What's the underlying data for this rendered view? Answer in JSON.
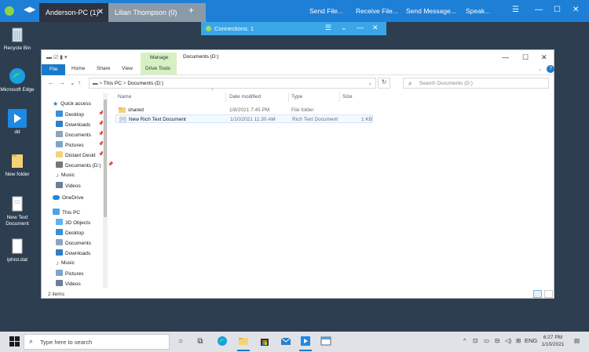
{
  "topbar": {
    "tabs": [
      {
        "label": "Anderson-PC (1)",
        "close": "✕"
      },
      {
        "label": "Lilian Thompson (0)"
      }
    ],
    "new_tab": "+",
    "actions": [
      "Send File...",
      "Receive File...",
      "Send Message...",
      "Speak..."
    ]
  },
  "connections": {
    "label": "Connections: 1"
  },
  "desktop": {
    "icons": [
      "Recycle Bin",
      "Microsoft Edge",
      "dd",
      "New folder",
      "New Text Document",
      "iphist.dat"
    ]
  },
  "explorer": {
    "title": "Documents (D:)",
    "ribbon": {
      "file": "File",
      "tabs": [
        "Home",
        "Share",
        "View"
      ],
      "manage": "Manage",
      "drive_tools": "Drive Tools"
    },
    "address": {
      "crumbs": [
        "This PC",
        "Documents (D:)"
      ],
      "separator": ">",
      "search_placeholder": "Search Documents (D:)"
    },
    "nav": {
      "quick_access": "Quick access",
      "quick_items": [
        "Desktop",
        "Downloads",
        "Documents",
        "Pictures",
        "Distant Deskt",
        "Documents (D:)",
        "Music",
        "Videos"
      ],
      "onedrive": "OneDrive",
      "this_pc": "This PC",
      "pc_items": [
        "3D Objects",
        "Desktop",
        "Documents",
        "Downloads",
        "Music",
        "Pictures",
        "Videos"
      ]
    },
    "columns": {
      "name": "Name",
      "date": "Date modified",
      "type": "Type",
      "size": "Size"
    },
    "files": [
      {
        "name": "shared",
        "date": "1/8/2021 7:45 PM",
        "type": "File folder",
        "size": "",
        "icon": "folder-icon"
      },
      {
        "name": "New Rich Text Document",
        "date": "1/10/2021 11:30 AM",
        "type": "Rich Text Document",
        "size": "1 KB",
        "icon": "rtf-icon"
      }
    ],
    "status": "2 items"
  },
  "taskbar": {
    "search_placeholder": "Type here to search",
    "tray_lang": "ENG",
    "time": "6:27 PM",
    "date": "1/10/2021"
  },
  "colors": {
    "topbar": "#1e7fd6",
    "connbar": "#3aa6e8",
    "desktop": "#2c3e50",
    "accent": "#1979ca",
    "manage_tab": "#d7f0c2"
  }
}
